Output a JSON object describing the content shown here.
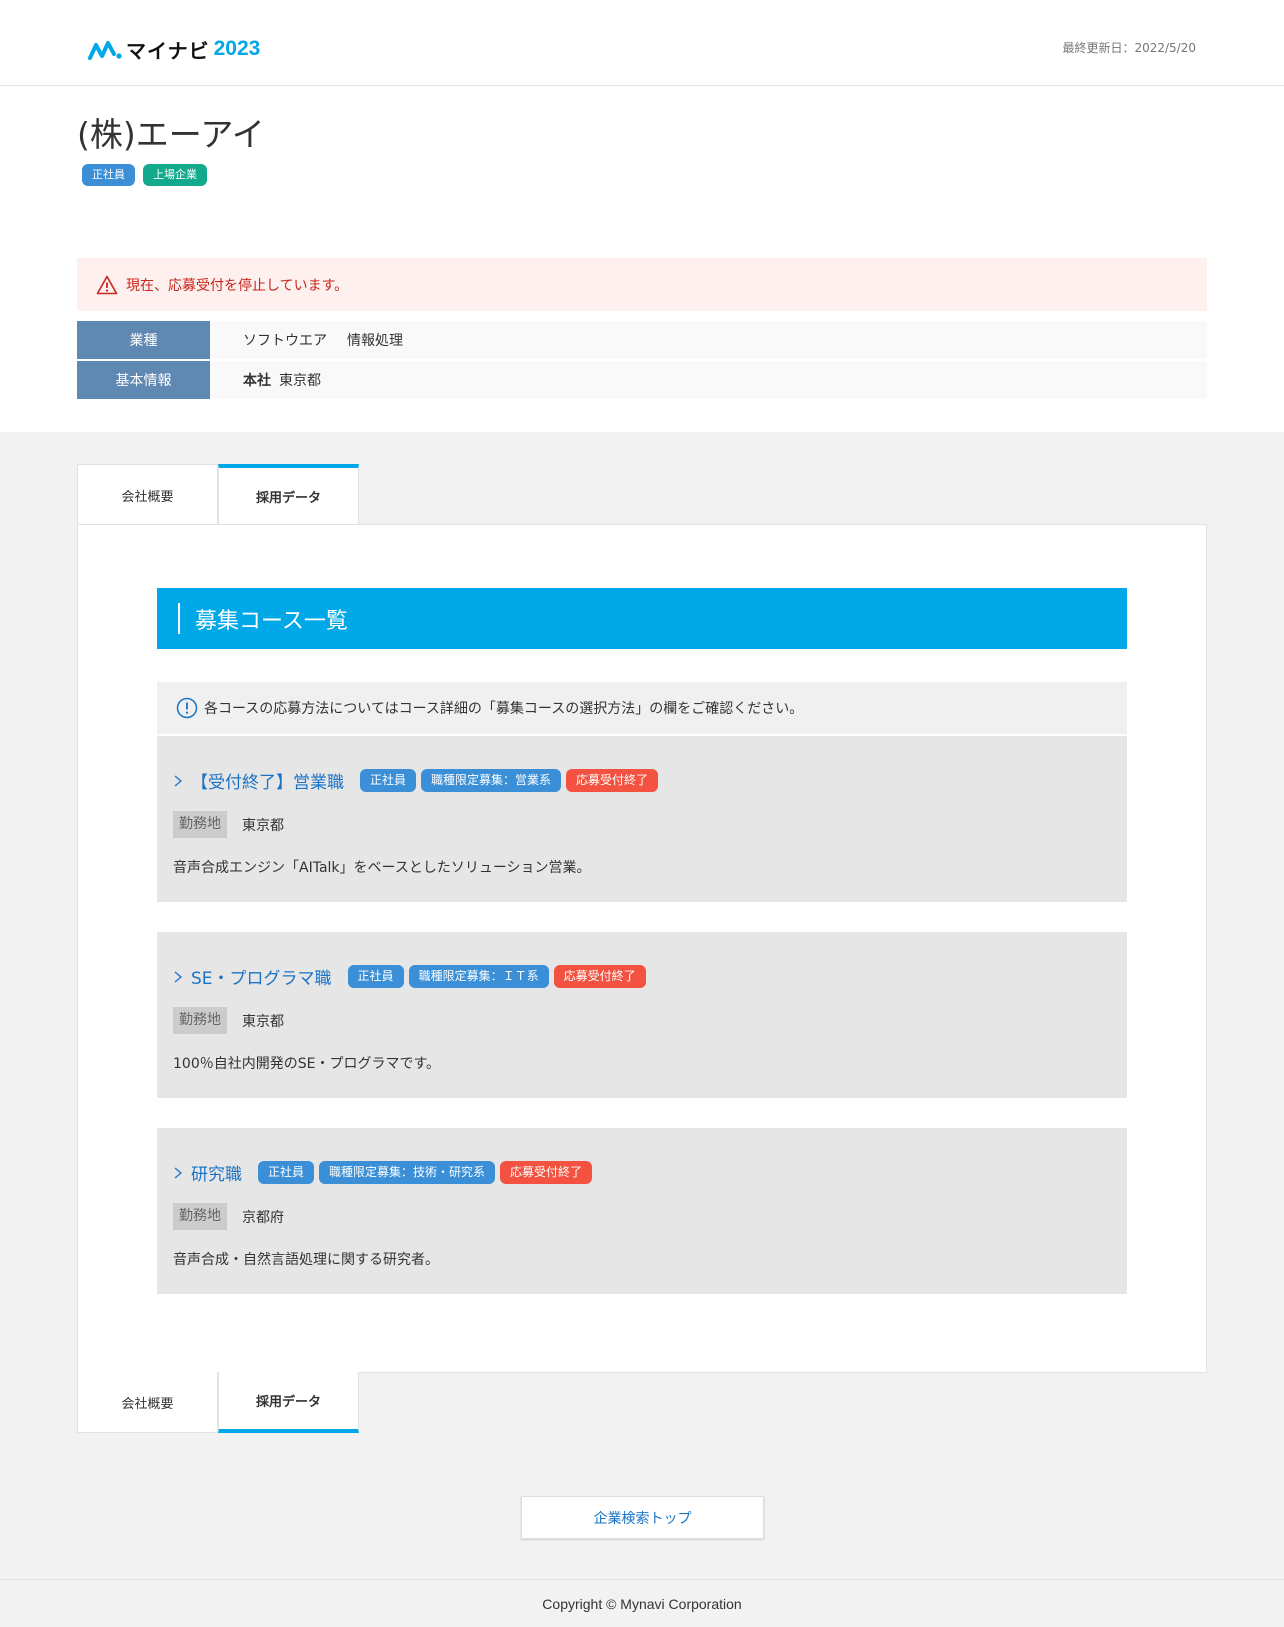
{
  "header": {
    "logo_name": "マイナビ",
    "logo_year": "2023",
    "updated": "最終更新日：2022/5/20"
  },
  "company": {
    "name": "(株)エーアイ",
    "chips": [
      "正社員",
      "上場企業"
    ]
  },
  "alert": {
    "text": "現在、応募受付を停止しています。"
  },
  "info": {
    "industry_label": "業種",
    "industry_1": "ソフトウエア",
    "industry_2": "情報処理",
    "basic_label": "基本情報",
    "hq_label": "本社",
    "hq_value": "東京都"
  },
  "tabs": {
    "overview": "会社概要",
    "recruit": "採用データ"
  },
  "section": {
    "title": "募集コース一覧",
    "notice": "各コースの応募方法についてはコース詳細の「募集コースの選択方法」の欄をご確認ください。"
  },
  "courses": [
    {
      "title": "【受付終了】営業職",
      "tag1": "正社員",
      "tag2": "職種限定募集：営業系",
      "tag3": "応募受付終了",
      "loc_label": "勤務地",
      "loc": "東京都",
      "desc": "音声合成エンジン「AITalk」をベースとしたソリューション営業。"
    },
    {
      "title": "SE・プログラマ職",
      "tag1": "正社員",
      "tag2": "職種限定募集：ＩＴ系",
      "tag3": "応募受付終了",
      "loc_label": "勤務地",
      "loc": "東京都",
      "desc": "100％自社内開発のSE・プログラマです。"
    },
    {
      "title": "研究職",
      "tag1": "正社員",
      "tag2": "職種限定募集：技術・研究系",
      "tag3": "応募受付終了",
      "loc_label": "勤務地",
      "loc": "京都府",
      "desc": "音声合成・自然言語処理に関する研究者。"
    }
  ],
  "search_top": "企業検索トップ",
  "footer": "Copyright © Mynavi Corporation",
  "colors": {
    "accent": "#00a8e8",
    "link": "#1a73c7",
    "tag_blue": "#3a8fd6",
    "tag_red": "#f2523f",
    "chip_green": "#13a98c",
    "alert_text": "#c9261c",
    "table_header": "#5f89b2"
  },
  "icons": [
    "mynavi-logo-icon",
    "warning-icon",
    "info-icon",
    "chevron-right-icon"
  ]
}
